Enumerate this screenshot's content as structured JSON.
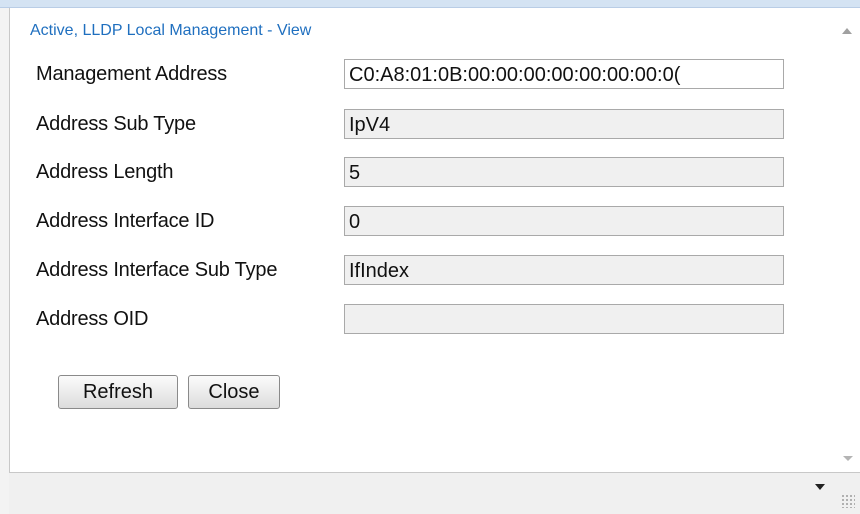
{
  "dialog": {
    "title": "Active, LLDP Local Management - View"
  },
  "fields": [
    {
      "label": "Management Address",
      "value": "C0:A8:01:0B:00:00:00:00:00:00:00:0("
    },
    {
      "label": "Address Sub Type",
      "value": "IpV4"
    },
    {
      "label": "Address Length",
      "value": "5"
    },
    {
      "label": "Address Interface ID",
      "value": "0"
    },
    {
      "label": "Address Interface Sub Type",
      "value": "IfIndex"
    },
    {
      "label": "Address OID",
      "value": ""
    }
  ],
  "buttons": {
    "refresh_label": "Refresh",
    "close_label": "Close"
  },
  "colors": {
    "title": "#1f6fbf",
    "field_bg": "#f0f0f0",
    "field_border": "#a9a9a9"
  },
  "icons": [
    "scroll-up-icon",
    "scroll-down-icon",
    "dropdown-arrow-icon",
    "resize-grip-icon"
  ]
}
